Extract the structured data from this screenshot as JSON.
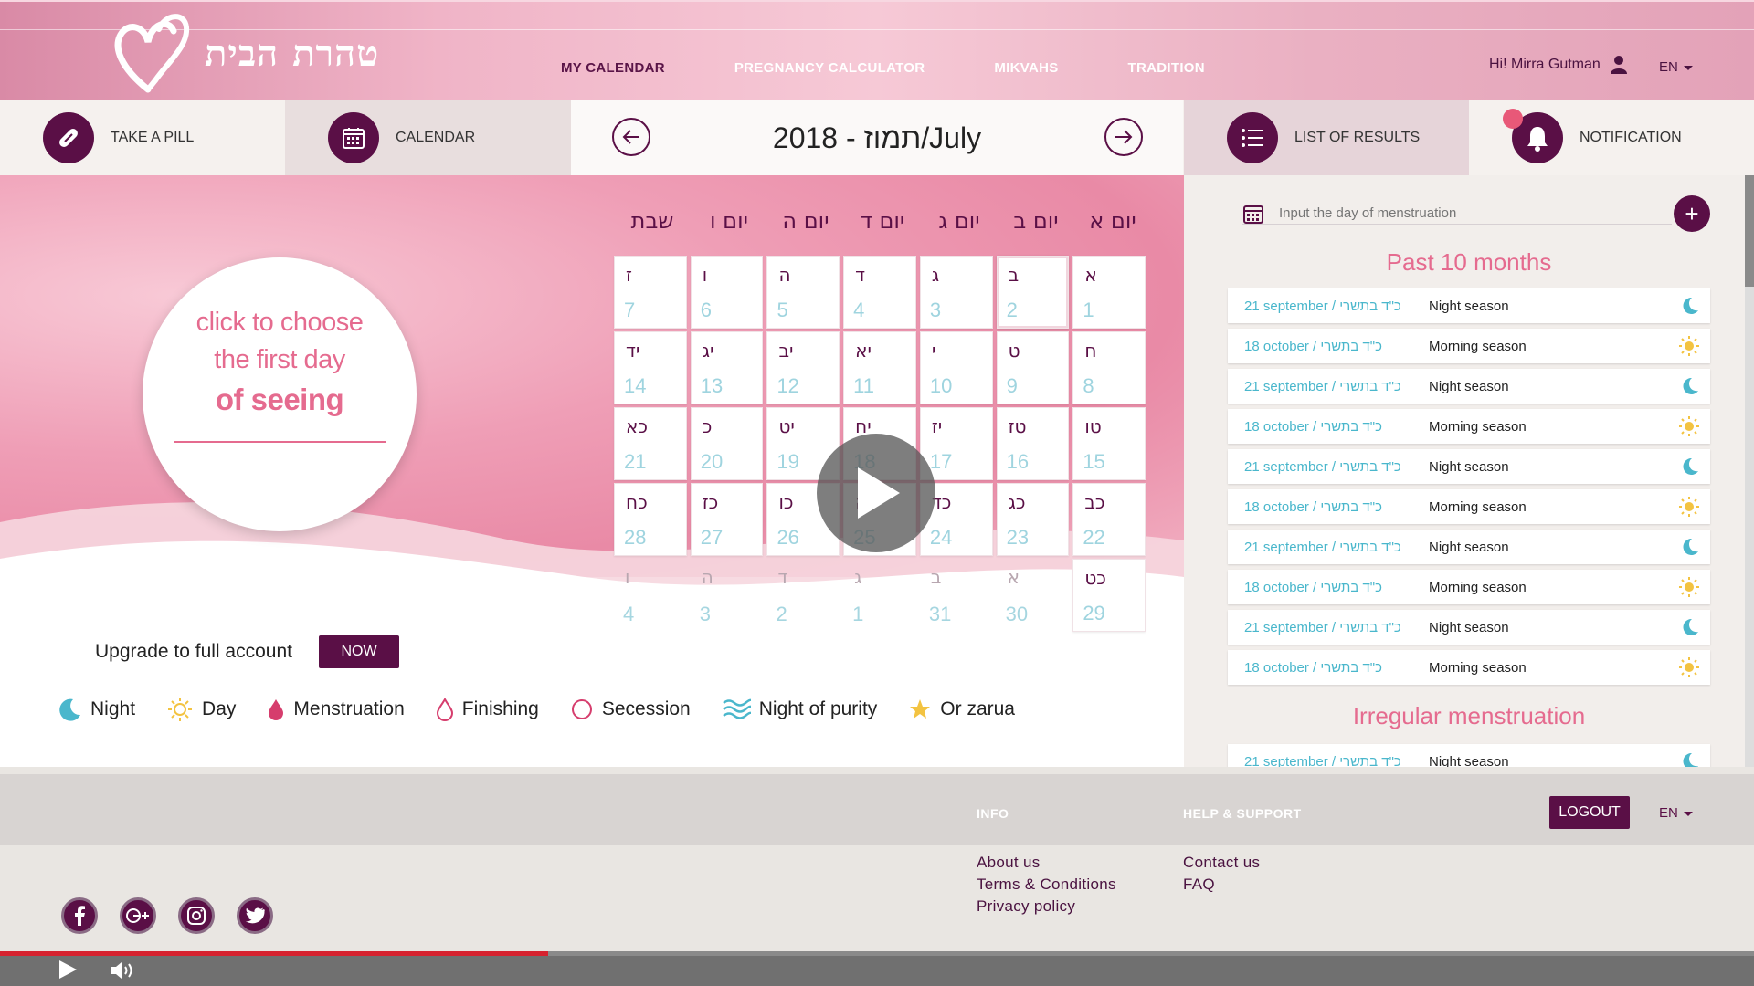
{
  "brand": {
    "logo_text": "טהרת הבית"
  },
  "nav": [
    {
      "label": "MY CALENDAR",
      "active": true
    },
    {
      "label": "PREGNANCY CALCULATOR",
      "active": false
    },
    {
      "label": "MIKVAHS",
      "active": false
    },
    {
      "label": "TRADITION",
      "active": false
    }
  ],
  "user": {
    "greeting": "Hi! Mirra Gutman",
    "lang": "EN"
  },
  "toolbar": {
    "take_pill": "TAKE A PILL",
    "calendar": "CALENDAR",
    "month_title": "2018 - תמוז/July",
    "list_of_results": "LIST OF RESULTS",
    "notification": "NOTIFICATION"
  },
  "choose": {
    "line1": "click to choose",
    "line2": "the first day",
    "line3": "of seeing"
  },
  "calendar": {
    "weekdays": [
      "שבת",
      "יום ו",
      "יום ה",
      "יום ד",
      "יום ג",
      "יום ב",
      "יום א"
    ],
    "rows": [
      [
        [
          "ז",
          "7"
        ],
        [
          "ו",
          "6"
        ],
        [
          "ה",
          "5"
        ],
        [
          "ד",
          "4"
        ],
        [
          "ג",
          "3"
        ],
        [
          "ב",
          "2"
        ],
        [
          "א",
          "1"
        ]
      ],
      [
        [
          "יד",
          "14"
        ],
        [
          "יג",
          "13"
        ],
        [
          "יב",
          "12"
        ],
        [
          "יא",
          "11"
        ],
        [
          "י",
          "10"
        ],
        [
          "ט",
          "9"
        ],
        [
          "ח",
          "8"
        ]
      ],
      [
        [
          "כא",
          "21"
        ],
        [
          "כ",
          "20"
        ],
        [
          "יט",
          "19"
        ],
        [
          "יח",
          "18"
        ],
        [
          "יז",
          "17"
        ],
        [
          "טז",
          "16"
        ],
        [
          "טו",
          "15"
        ]
      ],
      [
        [
          "כח",
          "28"
        ],
        [
          "כז",
          "27"
        ],
        [
          "כו",
          "26"
        ],
        [
          "כה",
          "25"
        ],
        [
          "כד",
          "24"
        ],
        [
          "כג",
          "23"
        ],
        [
          "כב",
          "22"
        ]
      ],
      [
        [
          "ו",
          "4"
        ],
        [
          "ה",
          "3"
        ],
        [
          "ד",
          "2"
        ],
        [
          "ג",
          "1"
        ],
        [
          "ב",
          "31"
        ],
        [
          "א",
          "30"
        ],
        [
          "כט",
          "29"
        ]
      ]
    ]
  },
  "upgrade": {
    "text": "Upgrade to full account",
    "button": "NOW"
  },
  "legend": [
    "Night",
    "Day",
    "Menstruation",
    "Finishing",
    "Secession",
    "Night of purity",
    "Or zarua"
  ],
  "right_panel": {
    "input_placeholder": "Input the day of menstruation",
    "past_title": "Past 10 months",
    "results": [
      {
        "date": "21 september / כ\"ד בתשרי",
        "season": "Night season",
        "icon": "moon-icon"
      },
      {
        "date": "18 october / כ\"ד בתשרי",
        "season": "Morning season",
        "icon": "sun-icon"
      },
      {
        "date": "21 september / כ\"ד בתשרי",
        "season": "Night season",
        "icon": "moon-icon"
      },
      {
        "date": "18 october / כ\"ד בתשרי",
        "season": "Morning season",
        "icon": "sun-icon"
      },
      {
        "date": "21 september / כ\"ד בתשרי",
        "season": "Night season",
        "icon": "moon-icon"
      },
      {
        "date": "18 october / כ\"ד בתשרי",
        "season": "Morning season",
        "icon": "sun-icon"
      },
      {
        "date": "21 september / כ\"ד בתשרי",
        "season": "Night season",
        "icon": "moon-icon"
      },
      {
        "date": "18 october / כ\"ד בתשרי",
        "season": "Morning season",
        "icon": "sun-icon"
      },
      {
        "date": "21 september / כ\"ד בתשרי",
        "season": "Night season",
        "icon": "moon-icon"
      },
      {
        "date": "18 october / כ\"ד בתשרי",
        "season": "Morning season",
        "icon": "sun-icon"
      }
    ],
    "irregular_title": "Irregular menstruation",
    "irregular": [
      {
        "date": "21 september / כ\"ד בתשרי",
        "season": "Night season",
        "icon": "moon-icon"
      }
    ]
  },
  "footer": {
    "info_head": "INFO",
    "help_head": "HELP & SUPPORT",
    "logout": "LOGOUT",
    "lang": "EN",
    "about": "About us",
    "terms": "Terms & Conditions",
    "privacy": "Privacy policy",
    "contact": "Contact us",
    "faq": "FAQ"
  },
  "colors": {
    "primary": "#5a0f46",
    "accent_pink": "#e56b8f",
    "teal": "#4ab7cc",
    "sun": "#f3c341"
  }
}
